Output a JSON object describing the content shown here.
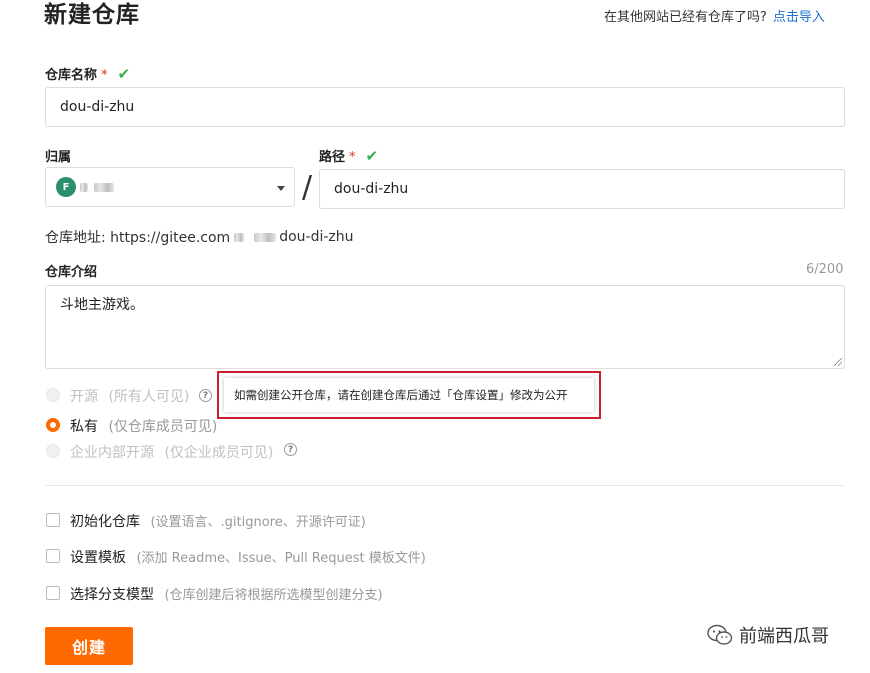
{
  "header": {
    "title": "新建仓库",
    "import_hint": "在其他网站已经有仓库了吗?",
    "import_link": "点击导入"
  },
  "repo_name": {
    "label": "仓库名称",
    "required_mark": "*",
    "value": "dou-di-zhu"
  },
  "owner": {
    "label": "归属",
    "avatar_letter": "F"
  },
  "path": {
    "label": "路径",
    "required_mark": "*",
    "separator": "/",
    "value": "dou-di-zhu"
  },
  "address": {
    "prefix": "仓库地址: https://gitee.com",
    "suffix": "dou-di-zhu"
  },
  "intro": {
    "label": "仓库介绍",
    "counter": "6/200",
    "value": "斗地主游戏。"
  },
  "visibility": {
    "options": [
      {
        "label": "开源",
        "note": "(所有人可见)",
        "state": "disabled"
      },
      {
        "label": "私有",
        "note": "(仅仓库成员可见)",
        "state": "checked"
      },
      {
        "label": "企业内部开源",
        "note": "(仅企业成员可见)",
        "state": "disabled"
      }
    ],
    "tooltip": "如需创建公开仓库，请在创建仓库后通过「仓库设置」修改为公开"
  },
  "options": [
    {
      "label": "初始化仓库",
      "note": "(设置语言、.gitignore、开源许可证)"
    },
    {
      "label": "设置模板",
      "note": "(添加 Readme、Issue、Pull Request 模板文件)"
    },
    {
      "label": "选择分支模型",
      "note": "(仓库创建后将根据所选模型创建分支)"
    }
  ],
  "submit": {
    "label": "创建"
  },
  "watermark": {
    "text": "前端西瓜哥"
  },
  "colors": {
    "accent": "#ff6a00",
    "link": "#1f6fd1",
    "valid": "#3bab4a",
    "required": "#e0301e",
    "highlight_frame": "#c91f2b"
  }
}
